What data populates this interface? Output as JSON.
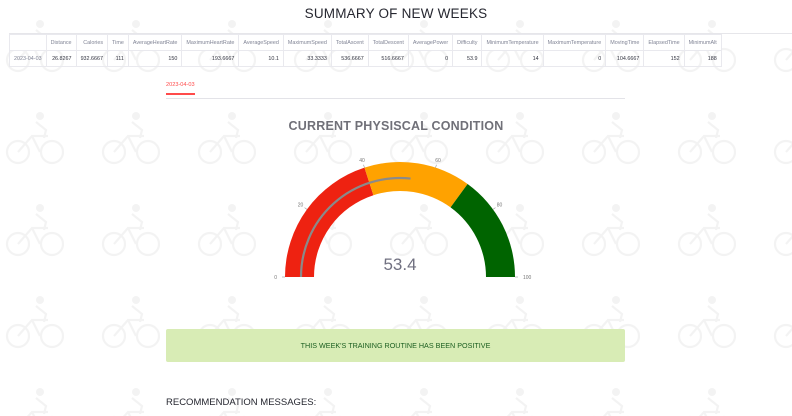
{
  "page": {
    "title": "SUMMARY OF NEW WEEKS",
    "section_title": "CURRENT PHYSISCAL CONDITION",
    "recommendation_title": "RECOMMENDATION MESSAGES:"
  },
  "table": {
    "columns": [
      "",
      "Distance",
      "Calories",
      "Time",
      "AverageHeartRate",
      "MaximumHeartRate",
      "AverageSpeed",
      "MaximumSpeed",
      "TotalAscent",
      "TotalDescent",
      "AveragePower",
      "Difficulty",
      "MinimumTemperature",
      "MaximumTemperature",
      "MovingTime",
      "ElapsedTime",
      "MinimumAlt"
    ],
    "rows": [
      [
        "2023-04-03",
        "26.8267",
        "932.6667",
        "111",
        "150",
        "193.6667",
        "10.1",
        "33.3333",
        "536.6667",
        "516.6667",
        "0",
        "53.9",
        "14",
        "0",
        "104.6667",
        "152",
        "188"
      ]
    ]
  },
  "tabs": [
    "2023-04-03"
  ],
  "gauge": {
    "value": "53.4",
    "min": 0,
    "max": 100,
    "ticks": [
      "0",
      "20",
      "40",
      "60",
      "80",
      "100"
    ],
    "bands": [
      {
        "from": 0,
        "to": 40,
        "color": "#ee2211"
      },
      {
        "from": 40,
        "to": 70,
        "color": "#ffa200"
      },
      {
        "from": 70,
        "to": 100,
        "color": "#006400"
      }
    ],
    "bar_color": "#8a8a8a"
  },
  "alert": {
    "message": "THIS WEEK'S TRAINING ROUTINE HAS BEEN POSITIVE",
    "background": "#d8ecb5",
    "text_color": "#1b5e20"
  }
}
